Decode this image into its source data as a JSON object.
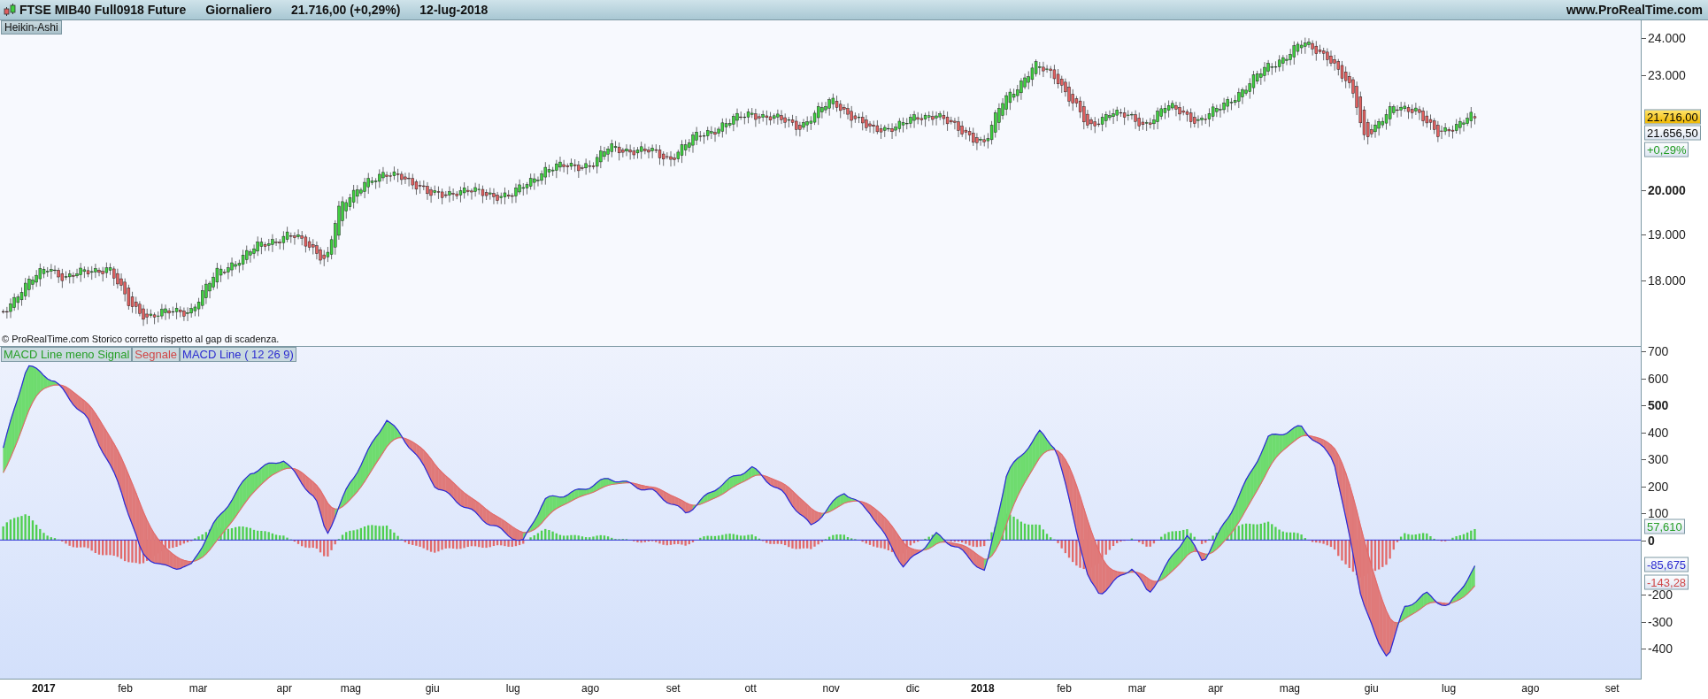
{
  "header": {
    "title": "FTSE MIB40 Full0918 Future",
    "period": "Giornaliero",
    "price": "21.716,00 (+0,29%)",
    "date": "12-lug-2018",
    "site": "www.ProRealTime.com"
  },
  "price_panel": {
    "style_label": "Heikin-Ashi",
    "footnote": "© ProRealTime.com  Storico corretto rispetto al gap di scadenza.",
    "axis_ticks": [
      {
        "label": "24.000",
        "emphasized": false
      },
      {
        "label": "23.000",
        "emphasized": false
      },
      {
        "label": "20.000",
        "emphasized": true
      },
      {
        "label": "19.000",
        "emphasized": false
      },
      {
        "label": "18.000",
        "emphasized": false
      }
    ],
    "badges": [
      {
        "text": "21.716,00",
        "highlight": true,
        "kind": "price"
      },
      {
        "text": "21.656,50",
        "highlight": false,
        "kind": "price"
      },
      {
        "text": "+0,29%",
        "highlight": false,
        "kind": "change"
      }
    ]
  },
  "macd_panel": {
    "legend": [
      {
        "text": "MACD Line meno Signal",
        "kind": "histogram"
      },
      {
        "text": "Segnale",
        "kind": "signal"
      },
      {
        "text": "MACD Line ( 12 26 9)",
        "kind": "macd"
      }
    ],
    "axis_ticks": [
      {
        "label": "700",
        "emphasized": false
      },
      {
        "label": "600",
        "emphasized": false
      },
      {
        "label": "500",
        "emphasized": true
      },
      {
        "label": "400",
        "emphasized": false
      },
      {
        "label": "300",
        "emphasized": false
      },
      {
        "label": "200",
        "emphasized": false
      },
      {
        "label": "100",
        "emphasized": false
      },
      {
        "label": "0",
        "emphasized": true
      },
      {
        "label": "-200",
        "emphasized": false
      },
      {
        "label": "-300",
        "emphasized": false
      },
      {
        "label": "-400",
        "emphasized": false
      }
    ],
    "badges": [
      {
        "text": "57,610",
        "kind": "histogram"
      },
      {
        "text": "-85,675",
        "kind": "macd"
      },
      {
        "text": "-143,28",
        "kind": "signal"
      }
    ]
  },
  "time_axis": [
    {
      "label": "2017",
      "emphasized": true
    },
    {
      "label": "feb",
      "emphasized": false
    },
    {
      "label": "mar",
      "emphasized": false
    },
    {
      "label": "apr",
      "emphasized": false
    },
    {
      "label": "mag",
      "emphasized": false
    },
    {
      "label": "giu",
      "emphasized": false
    },
    {
      "label": "lug",
      "emphasized": false
    },
    {
      "label": "ago",
      "emphasized": false
    },
    {
      "label": "set",
      "emphasized": false
    },
    {
      "label": "ott",
      "emphasized": false
    },
    {
      "label": "nov",
      "emphasized": false
    },
    {
      "label": "dic",
      "emphasized": false
    },
    {
      "label": "2018",
      "emphasized": true
    },
    {
      "label": "feb",
      "emphasized": false
    },
    {
      "label": "mar",
      "emphasized": false
    },
    {
      "label": "apr",
      "emphasized": false
    },
    {
      "label": "mag",
      "emphasized": false
    },
    {
      "label": "giu",
      "emphasized": false
    },
    {
      "label": "lug",
      "emphasized": false
    },
    {
      "label": "ago",
      "emphasized": false
    },
    {
      "label": "set",
      "emphasized": false
    }
  ]
}
